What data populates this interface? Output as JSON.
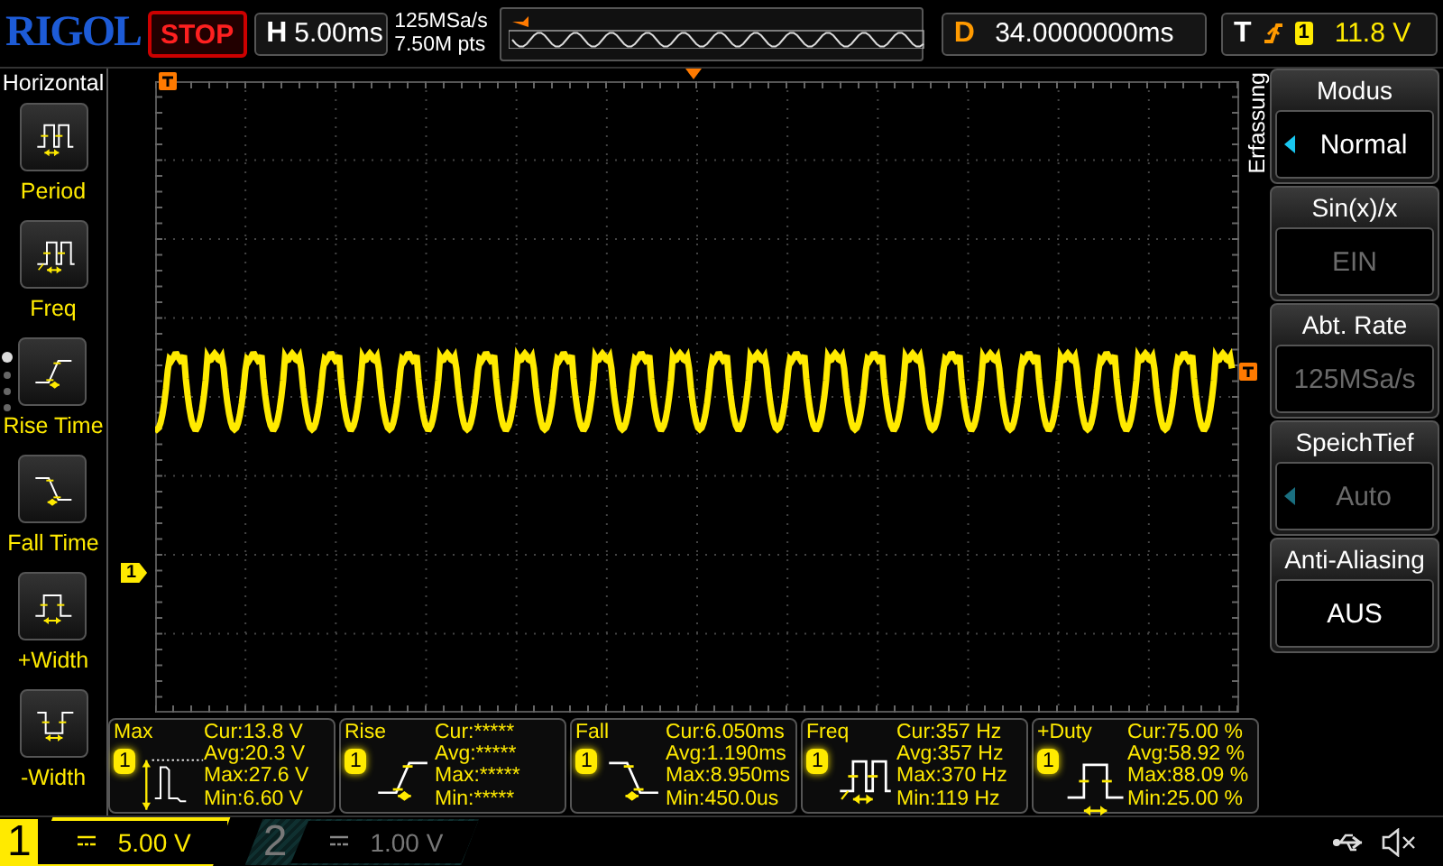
{
  "top_bar": {
    "brand": "RIGOL",
    "run_state": "STOP",
    "timebase": {
      "label": "H",
      "value": "5.00ms"
    },
    "sample_rate": "125MSa/s",
    "memory_depth": "7.50M pts",
    "delay": {
      "label": "D",
      "value": "34.0000000ms"
    },
    "trigger": {
      "label": "T",
      "channel": "1",
      "level": "11.8 V"
    }
  },
  "left_menu": {
    "title": "Horizontal",
    "pages": [
      {
        "selected": true
      },
      {
        "selected": false
      },
      {
        "selected": false
      },
      {
        "selected": false
      }
    ],
    "items": [
      {
        "kind": "period",
        "label": "Period"
      },
      {
        "kind": "freq",
        "label": "Freq"
      },
      {
        "kind": "rise",
        "label": "Rise Time"
      },
      {
        "kind": "fall",
        "label": "Fall Time"
      },
      {
        "kind": "pwidth",
        "label": "+Width"
      },
      {
        "kind": "nwidth",
        "label": "-Width"
      }
    ]
  },
  "screen": {
    "channel_marker": "1"
  },
  "right_menu": {
    "title": "Erfassung",
    "items": [
      {
        "label": "Modus",
        "value": "Normal",
        "knob": true,
        "disabled": false
      },
      {
        "label": "Sin(x)/x",
        "value": "EIN",
        "knob": false,
        "disabled": true
      },
      {
        "label": "Abt. Rate",
        "value": "125MSa/s",
        "knob": false,
        "disabled": true
      },
      {
        "label": "SpeichTief",
        "value": "Auto",
        "knob": true,
        "disabled": true
      },
      {
        "label": "Anti-Aliasing",
        "value": "AUS",
        "knob": false,
        "disabled": false
      }
    ]
  },
  "measurements": [
    {
      "kind": "max",
      "name": "Max",
      "channel": "1",
      "lines": [
        "Cur:13.8 V",
        "Avg:20.3 V",
        "Max:27.6 V",
        "Min:6.60 V"
      ]
    },
    {
      "kind": "rise",
      "name": "Rise",
      "channel": "1",
      "lines": [
        "Cur:*****",
        "Avg:*****",
        "Max:*****",
        "Min:*****"
      ]
    },
    {
      "kind": "fall",
      "name": "Fall",
      "channel": "1",
      "lines": [
        "Cur:6.050ms",
        "Avg:1.190ms",
        "Max:8.950ms",
        "Min:450.0us"
      ]
    },
    {
      "kind": "freq",
      "name": "Freq",
      "channel": "1",
      "lines": [
        "Cur:357 Hz",
        "Avg:357 Hz",
        "Max:370 Hz",
        "Min:119 Hz"
      ]
    },
    {
      "kind": "duty",
      "name": "+Duty",
      "channel": "1",
      "lines": [
        "Cur:75.00 %",
        "Avg:58.92 %",
        "Max:88.09 %",
        "Min:25.00 %"
      ]
    }
  ],
  "channels": [
    {
      "number": "1",
      "scale": "5.00 V",
      "on": true
    },
    {
      "number": "2",
      "scale": "1.00 V",
      "on": false
    }
  ]
}
